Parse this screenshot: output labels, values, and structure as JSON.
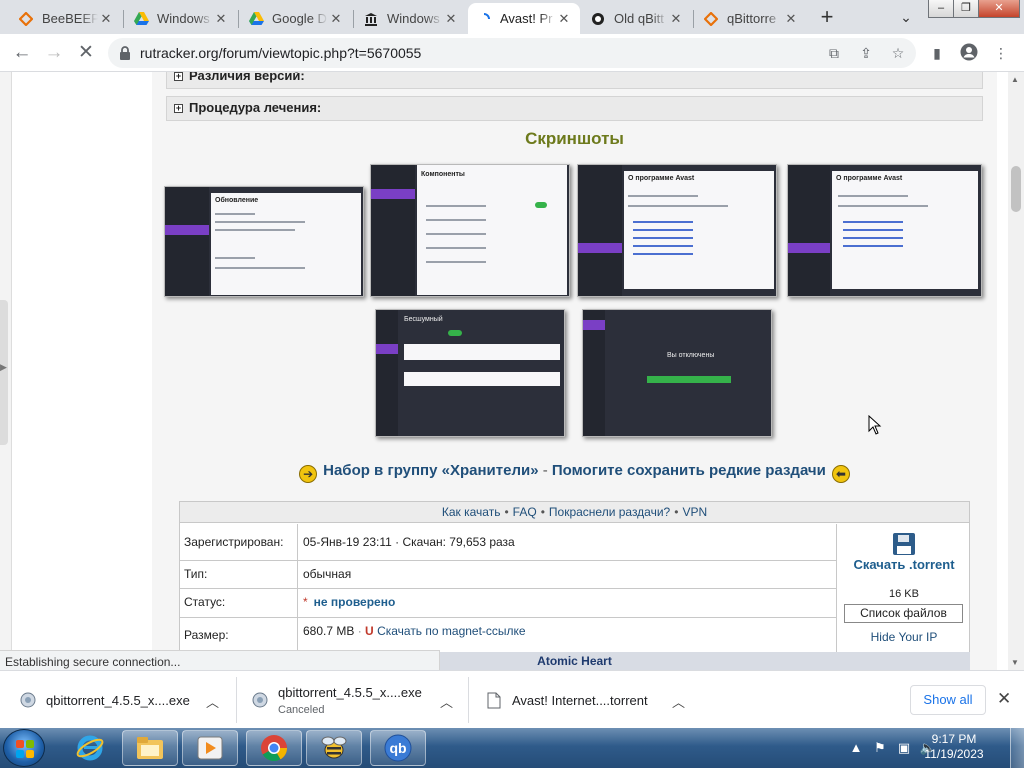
{
  "tabs": [
    {
      "label": "BeeBEEP",
      "icon": "beebeep-icon",
      "color": "#e8710a"
    },
    {
      "label": "Windows",
      "icon": "google-drive-icon",
      "color": "#1a73e8"
    },
    {
      "label": "Google D",
      "icon": "google-drive-icon",
      "color": "#1a73e8"
    },
    {
      "label": "Windows",
      "icon": "museum-icon",
      "color": "#222"
    },
    {
      "label": "Avast! Pr",
      "icon": "loading-icon",
      "color": "#1a73e8"
    },
    {
      "label": "Old qBitt",
      "icon": "github-icon",
      "color": "#222"
    },
    {
      "label": "qBittorre",
      "icon": "beebeep-icon",
      "color": "#e8710a"
    }
  ],
  "browser": {
    "url": "rutracker.org/forum/viewtopic.php?t=5670055"
  },
  "post": {
    "spoilers": [
      "Различия версий:",
      "Процедура лечения:"
    ],
    "screenshots_title": "Скриншоты",
    "screenshots": [
      {
        "title": "Обновление"
      },
      {
        "title": "Компоненты"
      },
      {
        "title": "О программе Avast"
      },
      {
        "title": "О программе Avast"
      },
      {
        "title": "Бесшумный"
      },
      {
        "title": "Вы отключены"
      }
    ],
    "guardian_part1": "Набор в группу «Хранители»",
    "guardian_dash": " - ",
    "guardian_part2": "Помогите сохранить редкие раздачи"
  },
  "info": {
    "links": [
      "Как качать",
      "FAQ",
      "Покраснели раздачи?",
      "VPN"
    ],
    "link_sep": "•",
    "rows": [
      {
        "key": "Зарегистрирован:",
        "value": "05-Янв-19 23:11 · Скачан: 79,653 раза"
      },
      {
        "key": "Тип:",
        "value": "обычная"
      },
      {
        "key": "Статус:",
        "value": "не проверено",
        "star": "*"
      },
      {
        "key": "Размер:",
        "value": "680.7 MB",
        "magnet": "Скачать по magnet-ссылке"
      }
    ],
    "download_label": "Скачать .torrent",
    "download_size": "16 KB",
    "file_list": "Список файлов",
    "hide_ip": "Hide Your IP",
    "next_section": "Atomic Heart"
  },
  "status_text": "Establishing secure connection...",
  "downloads": [
    {
      "name": "qbittorrent_4.5.5_x....exe",
      "sub": ""
    },
    {
      "name": "qbittorrent_4.5.5_x....exe",
      "sub": "Canceled"
    },
    {
      "name": "Avast! Internet....torrent",
      "sub": ""
    }
  ],
  "show_all": "Show all",
  "taskbar": {
    "time": "9:17 PM",
    "date": "11/19/2023"
  },
  "colors": {
    "accent": "#1a73e8",
    "link": "#204f7a",
    "heading": "#6d7a1c",
    "status_red": "#c0392b",
    "status_text": "#1e5e8e"
  }
}
